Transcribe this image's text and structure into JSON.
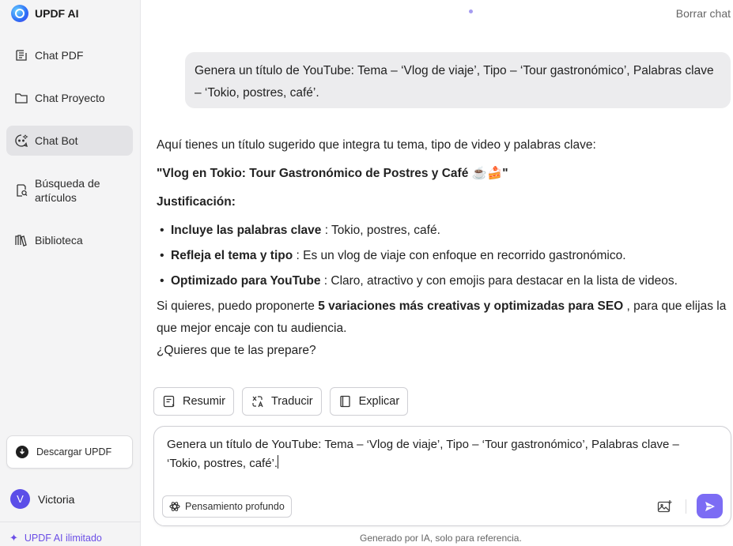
{
  "brand": {
    "name": "UPDF AI"
  },
  "sidebar": {
    "items": [
      {
        "label": "Chat PDF",
        "icon": "chat-pdf-icon"
      },
      {
        "label": "Chat Proyecto",
        "icon": "folder-icon"
      },
      {
        "label": "Chat Bot",
        "icon": "bot-icon",
        "active": true
      },
      {
        "label": "Búsqueda de artículos",
        "line1": "Búsqueda de",
        "line2": "artículos",
        "icon": "search-doc-icon"
      },
      {
        "label": "Biblioteca",
        "icon": "library-icon"
      }
    ],
    "download_label": "Descargar UPDF",
    "user": {
      "initial": "V",
      "name": "Victoria"
    },
    "unlimited_label": "UPDF AI ilimitado"
  },
  "header": {
    "clear_chat": "Borrar chat"
  },
  "chat": {
    "user_message": "Genera un título de YouTube: Tema – ‘Vlog de viaje’, Tipo – ‘Tour gastronómico’, Palabras clave – ‘Tokio, postres, café’.",
    "answer": {
      "intro": "Aquí tienes un título sugerido que integra tu tema, tipo de video y palabras clave:",
      "title": "\"Vlog en Tokio: Tour Gastronómico de Postres y Café ☕🍰\"",
      "justification_label": "Justificación:",
      "bullets": [
        {
          "bold": "Incluye las palabras clave",
          "text": " : Tokio, postres, café."
        },
        {
          "bold": "Refleja el tema y tipo",
          "text": " : Es un vlog de viaje con enfoque en recorrido gastronómico."
        },
        {
          "bold": "Optimizado para YouTube",
          "text": " : Claro, atractivo y con emojis para destacar en la lista de videos."
        }
      ],
      "more_prefix": "Si quieres, puedo proponerte ",
      "more_bold": "5 variaciones más creativas y optimizadas para SEO",
      "more_suffix": " , para que elijas la que mejor encaje con tu audiencia.",
      "question": "¿Quieres que te las prepare?"
    },
    "actions": [
      {
        "label": "Resumir",
        "icon": "summarize-icon"
      },
      {
        "label": "Traducir",
        "icon": "translate-icon"
      },
      {
        "label": "Explicar",
        "icon": "explain-icon"
      }
    ]
  },
  "composer": {
    "text": "Genera un título de YouTube: Tema – ‘Vlog de viaje’, Tipo – ‘Tour gastronómico’, Palabras clave – ‘Tokio, postres, café’.",
    "deep_think_label": "Pensamiento profundo"
  },
  "footer_note": "Generado por IA, solo para referencia.",
  "colors": {
    "accent": "#7c6cf4",
    "brand_purple": "#6b4ee6",
    "bubble": "#ececee",
    "sidebar": "#f4f4f5"
  }
}
